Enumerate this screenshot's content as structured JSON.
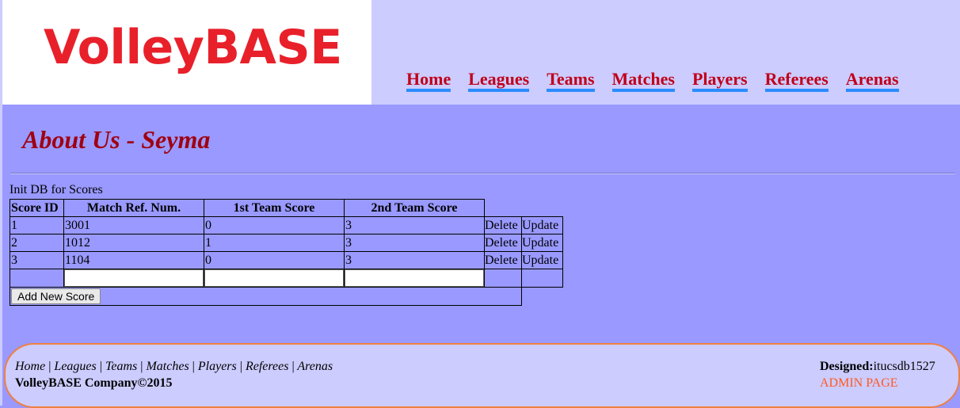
{
  "header": {
    "logo_text": "VolleyBASE",
    "nav": [
      "Home",
      "Leagues",
      "Teams",
      "Matches",
      "Players",
      "Referees",
      "Arenas"
    ]
  },
  "page": {
    "title": "About Us - Seyma",
    "init_label": "Init DB for Scores"
  },
  "table": {
    "headers": [
      "Score ID",
      "Match Ref. Num.",
      "1st Team Score",
      "2nd Team Score"
    ],
    "rows": [
      {
        "id": "1",
        "match": "3001",
        "team1": "0",
        "team2": "3",
        "delete": "Delete",
        "update": "Update"
      },
      {
        "id": "2",
        "match": "1012",
        "team1": "1",
        "team2": "3",
        "delete": "Delete",
        "update": "Update"
      },
      {
        "id": "3",
        "match": "1104",
        "team1": "0",
        "team2": "3",
        "delete": "Delete",
        "update": "Update"
      }
    ],
    "new_row": {
      "match": "",
      "team1": "",
      "team2": ""
    },
    "add_button": "Add New Score"
  },
  "footer": {
    "links": [
      "Home",
      "Leagues",
      "Teams",
      "Matches",
      "Players",
      "Referees",
      "Arenas"
    ],
    "separator": "|",
    "company": "VolleyBASE Company©2015",
    "designed_label": "Designed:",
    "designed_value": "itucsdb1527",
    "admin_link": "ADMIN PAGE"
  },
  "colors": {
    "background": "#9999ff",
    "header_light": "#ccccff",
    "logo_red": "#e8202a",
    "nav_red": "#c0001a",
    "nav_underline": "#2a8cff",
    "title_red": "#a00010",
    "footer_border": "#f08040",
    "admin_orange": "#ff5a1f"
  }
}
